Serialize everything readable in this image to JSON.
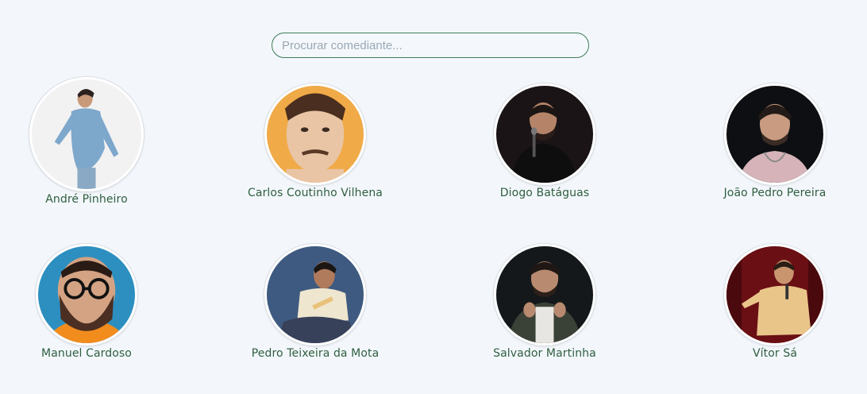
{
  "search": {
    "placeholder": "Procurar comediante..."
  },
  "comedians": [
    {
      "name": "André Pinheiro"
    },
    {
      "name": "Carlos Coutinho Vilhena"
    },
    {
      "name": "Diogo Batáguas"
    },
    {
      "name": "João Pedro Pereira"
    },
    {
      "name": "Manuel Cardoso"
    },
    {
      "name": "Pedro Teixeira da Mota"
    },
    {
      "name": "Salvador Martinha"
    },
    {
      "name": "Vítor Sá"
    }
  ]
}
